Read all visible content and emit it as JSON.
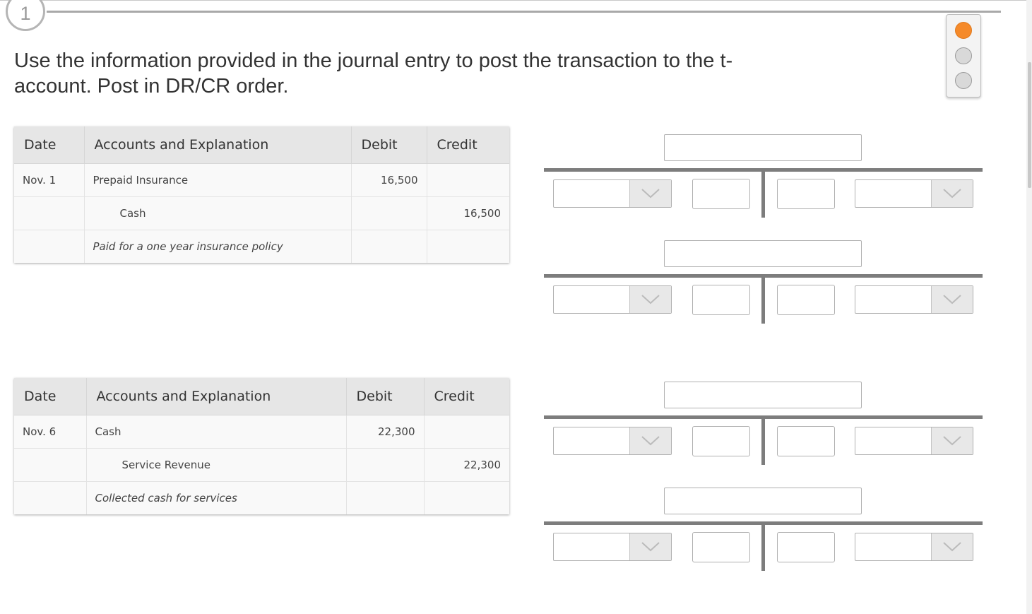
{
  "step": {
    "number": "1"
  },
  "instructions": "Use the information provided in the journal entry to post the transaction to the t-account. Post in DR/CR order.",
  "pager": {
    "total": 3,
    "active_index": 0,
    "active_color": "#f58a2a"
  },
  "journal_headers": [
    "Date",
    "Accounts and Explanation",
    "Debit",
    "Credit"
  ],
  "journals": [
    {
      "rows": [
        {
          "date": "Nov. 1",
          "account": "Prepaid Insurance",
          "debit": "16,500",
          "credit": ""
        },
        {
          "date": "",
          "account": "Cash",
          "debit": "",
          "credit": "16,500"
        }
      ],
      "explanation": "Paid for a one year insurance policy"
    },
    {
      "rows": [
        {
          "date": "Nov. 6",
          "account": "Cash",
          "debit": "22,300",
          "credit": ""
        },
        {
          "date": "",
          "account": "Service Revenue",
          "debit": "",
          "credit": "22,300"
        }
      ],
      "explanation": "Collected cash for services"
    }
  ],
  "taccounts": [
    {
      "title": "",
      "left_select": "",
      "left_amount": "",
      "right_amount": "",
      "right_select": ""
    },
    {
      "title": "",
      "left_select": "",
      "left_amount": "",
      "right_amount": "",
      "right_select": ""
    },
    {
      "title": "",
      "left_select": "",
      "left_amount": "",
      "right_amount": "",
      "right_select": ""
    },
    {
      "title": "",
      "left_select": "",
      "left_amount": "",
      "right_amount": "",
      "right_select": ""
    }
  ]
}
